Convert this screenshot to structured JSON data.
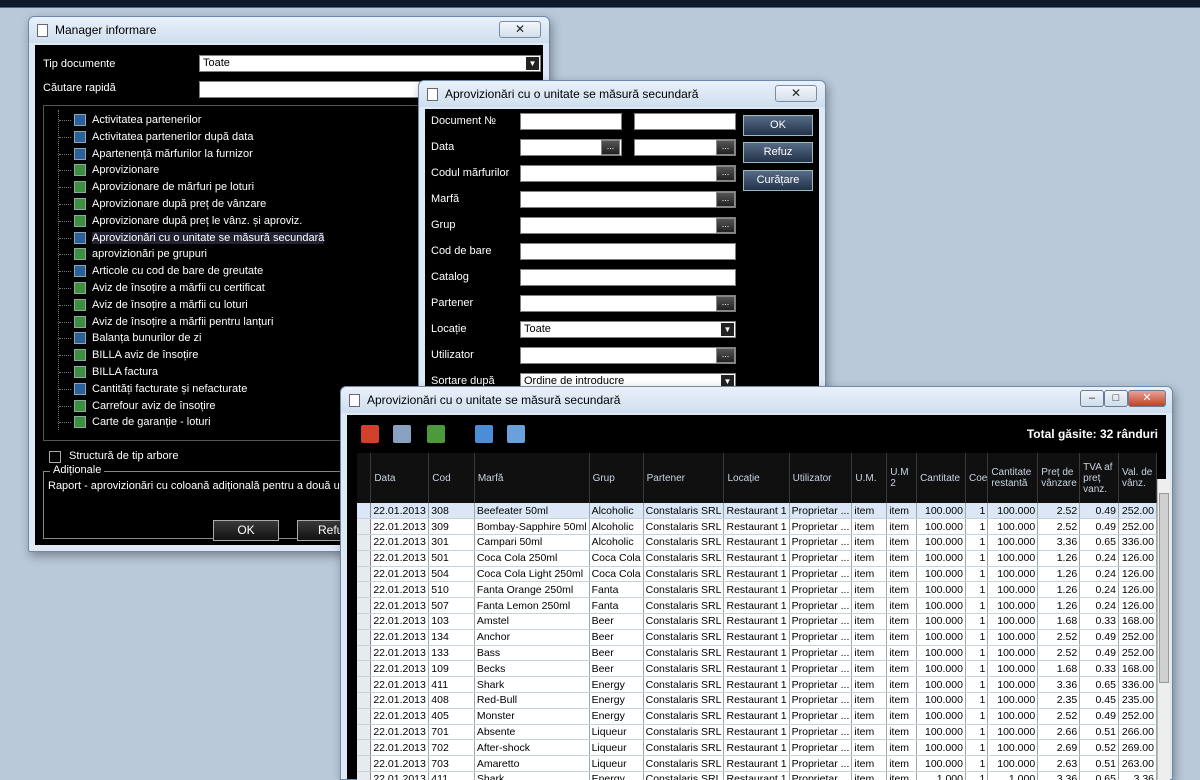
{
  "manager": {
    "title": "Manager informare",
    "tip_label": "Tip documente",
    "tip_value": "Toate",
    "search_label": "Căutare rapidă",
    "items": [
      {
        "label": "Activitatea partenerilor",
        "icon": "report-icon"
      },
      {
        "label": "Activitatea partenerilor după data",
        "icon": "report-icon"
      },
      {
        "label": "Apartenență mărfurilor la furnizor",
        "icon": "report-icon"
      },
      {
        "label": "Aprovizionare",
        "icon": "excel-icon"
      },
      {
        "label": "Aprovizionare de mărfuri pe loturi",
        "icon": "excel-icon"
      },
      {
        "label": "Aprovizionare după preț de vânzare",
        "icon": "excel-icon"
      },
      {
        "label": "Aprovizionare după preț le vânz. și aproviz.",
        "icon": "excel-icon"
      },
      {
        "label": "Aprovizionări cu o unitate se măsură secundară",
        "icon": "report-icon"
      },
      {
        "label": "aprovizionări pe grupuri",
        "icon": "excel-icon"
      },
      {
        "label": "Articole cu cod de bare de greutate",
        "icon": "report-icon"
      },
      {
        "label": "Aviz de însoțire a mărfii cu certificat",
        "icon": "excel-icon"
      },
      {
        "label": "Aviz de însoțire a mărfii cu loturi",
        "icon": "excel-icon"
      },
      {
        "label": "Aviz de însoțire a mărfii pentru lanțuri",
        "icon": "excel-icon"
      },
      {
        "label": "Balanța  bunurilor de zi",
        "icon": "report-icon"
      },
      {
        "label": "BILLA aviz de însoțire",
        "icon": "excel-icon"
      },
      {
        "label": "BILLA factura",
        "icon": "excel-icon"
      },
      {
        "label": "Cantități facturate și nefacturate",
        "icon": "report-icon"
      },
      {
        "label": "Carrefour aviz de însoțire",
        "icon": "excel-icon"
      },
      {
        "label": "Carte de garanție - loturi",
        "icon": "excel-icon"
      }
    ],
    "tree_checkbox_label": "Structură de tip arbore",
    "additional_label": "Adiționale",
    "additional_text": "Raport - aprovizionări cu coloană adițională pentru a două unita",
    "ok_label": "OK",
    "cancel_label": "Refu"
  },
  "filter": {
    "title": "Aprovizionări cu o unitate se măsură secundară",
    "labels": {
      "document": "Document №",
      "data": "Data",
      "cod_marfuri": "Codul mărfurilor",
      "marfa": "Marfă",
      "grup": "Grup",
      "cod_bare": "Cod de bare",
      "catalog": "Catalog",
      "partener": "Partener",
      "locatie": "Locație",
      "utilizator": "Utilizator",
      "sortare": "Sortare după"
    },
    "locatie_value": "Toate",
    "sortare_value": "Ordine de introducre",
    "ok_label": "OK",
    "refuz_label": "Refuz",
    "curatare_label": "Curățare"
  },
  "results": {
    "title": "Aprovizionări cu o unitate se măsură secundară",
    "total": "Total găsite: 32 rânduri",
    "columns": [
      "Data",
      "Cod",
      "Marfă",
      "Grup",
      "Partener",
      "Locație",
      "Utilizator",
      "U.M.",
      "U.M 2",
      "Cantitate",
      "Coe",
      "Cantitate restantă",
      "Preț de vânzare",
      "TVA af preț vanz.",
      "Val. de vânz."
    ],
    "rows": [
      [
        "22.01.2013",
        "308",
        "Beefeater 50ml",
        "Alcoholic",
        "Constalaris SRL",
        "Restaurant 1",
        "Proprietar ...",
        "item",
        "item",
        "100.000",
        "1",
        "100.000",
        "2.52",
        "0.49",
        "252.00"
      ],
      [
        "22.01.2013",
        "309",
        "Bombay-Sapphire 50ml",
        "Alcoholic",
        "Constalaris SRL",
        "Restaurant 1",
        "Proprietar ...",
        "item",
        "item",
        "100.000",
        "1",
        "100.000",
        "2.52",
        "0.49",
        "252.00"
      ],
      [
        "22.01.2013",
        "301",
        "Campari 50ml",
        "Alcoholic",
        "Constalaris SRL",
        "Restaurant 1",
        "Proprietar ...",
        "item",
        "item",
        "100.000",
        "1",
        "100.000",
        "3.36",
        "0.65",
        "336.00"
      ],
      [
        "22.01.2013",
        "501",
        "Coca Cola 250ml",
        "Coca Cola",
        "Constalaris SRL",
        "Restaurant 1",
        "Proprietar ...",
        "item",
        "item",
        "100.000",
        "1",
        "100.000",
        "1.26",
        "0.24",
        "126.00"
      ],
      [
        "22.01.2013",
        "504",
        "Coca Cola Light 250ml",
        "Coca Cola",
        "Constalaris SRL",
        "Restaurant 1",
        "Proprietar ...",
        "item",
        "item",
        "100.000",
        "1",
        "100.000",
        "1.26",
        "0.24",
        "126.00"
      ],
      [
        "22.01.2013",
        "510",
        "Fanta Orange 250ml",
        "Fanta",
        "Constalaris SRL",
        "Restaurant 1",
        "Proprietar ...",
        "item",
        "item",
        "100.000",
        "1",
        "100.000",
        "1.26",
        "0.24",
        "126.00"
      ],
      [
        "22.01.2013",
        "507",
        "Fanta Lemon 250ml",
        "Fanta",
        "Constalaris SRL",
        "Restaurant 1",
        "Proprietar ...",
        "item",
        "item",
        "100.000",
        "1",
        "100.000",
        "1.26",
        "0.24",
        "126.00"
      ],
      [
        "22.01.2013",
        "103",
        "Amstel",
        "Beer",
        "Constalaris SRL",
        "Restaurant 1",
        "Proprietar ...",
        "item",
        "item",
        "100.000",
        "1",
        "100.000",
        "1.68",
        "0.33",
        "168.00"
      ],
      [
        "22.01.2013",
        "134",
        "Anchor",
        "Beer",
        "Constalaris SRL",
        "Restaurant 1",
        "Proprietar ...",
        "item",
        "item",
        "100.000",
        "1",
        "100.000",
        "2.52",
        "0.49",
        "252.00"
      ],
      [
        "22.01.2013",
        "133",
        "Bass",
        "Beer",
        "Constalaris SRL",
        "Restaurant 1",
        "Proprietar ...",
        "item",
        "item",
        "100.000",
        "1",
        "100.000",
        "2.52",
        "0.49",
        "252.00"
      ],
      [
        "22.01.2013",
        "109",
        "Becks",
        "Beer",
        "Constalaris SRL",
        "Restaurant 1",
        "Proprietar ...",
        "item",
        "item",
        "100.000",
        "1",
        "100.000",
        "1.68",
        "0.33",
        "168.00"
      ],
      [
        "22.01.2013",
        "411",
        "Shark",
        "Energy",
        "Constalaris SRL",
        "Restaurant 1",
        "Proprietar ...",
        "item",
        "item",
        "100.000",
        "1",
        "100.000",
        "3.36",
        "0.65",
        "336.00"
      ],
      [
        "22.01.2013",
        "408",
        "Red-Bull",
        "Energy",
        "Constalaris SRL",
        "Restaurant 1",
        "Proprietar ...",
        "item",
        "item",
        "100.000",
        "1",
        "100.000",
        "2.35",
        "0.45",
        "235.00"
      ],
      [
        "22.01.2013",
        "405",
        "Monster",
        "Energy",
        "Constalaris SRL",
        "Restaurant 1",
        "Proprietar ...",
        "item",
        "item",
        "100.000",
        "1",
        "100.000",
        "2.52",
        "0.49",
        "252.00"
      ],
      [
        "22.01.2013",
        "701",
        "Absente",
        "Liqueur",
        "Constalaris SRL",
        "Restaurant 1",
        "Proprietar ...",
        "item",
        "item",
        "100.000",
        "1",
        "100.000",
        "2.66",
        "0.51",
        "266.00"
      ],
      [
        "22.01.2013",
        "702",
        "After-shock",
        "Liqueur",
        "Constalaris SRL",
        "Restaurant 1",
        "Proprietar ...",
        "item",
        "item",
        "100.000",
        "1",
        "100.000",
        "2.69",
        "0.52",
        "269.00"
      ],
      [
        "22.01.2013",
        "703",
        "Amaretto",
        "Liqueur",
        "Constalaris SRL",
        "Restaurant 1",
        "Proprietar ...",
        "item",
        "item",
        "100.000",
        "1",
        "100.000",
        "2.63",
        "0.51",
        "263.00"
      ],
      [
        "22.01.2013",
        "411",
        "Shark",
        "Energy",
        "Constalaris SRL",
        "Restaurant 1",
        "Proprietar ...",
        "item",
        "item",
        "1.000",
        "1",
        "1.000",
        "3.36",
        "0.65",
        "3.36"
      ]
    ]
  }
}
